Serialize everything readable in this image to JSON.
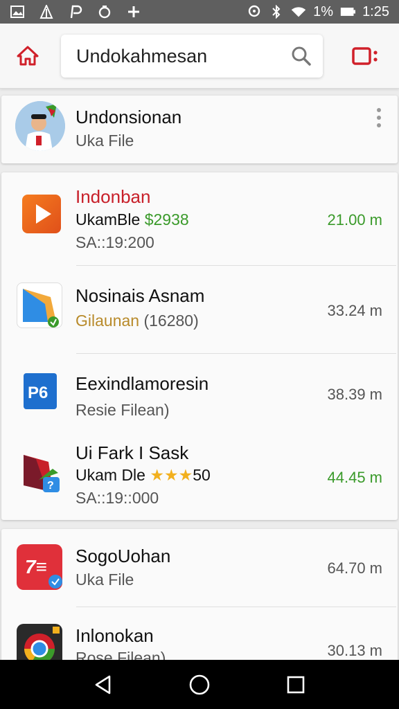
{
  "status_bar": {
    "battery_percent": "1%",
    "time": "1:25"
  },
  "search": {
    "value": "Undokahmesan"
  },
  "profile": {
    "name": "Undonsionan",
    "subtitle": "Uka File"
  },
  "list": [
    {
      "title": "Indonban",
      "subtitle_prefix": "UkamBle",
      "subtitle_highlight": "$2938",
      "meta": "SA::19:200",
      "size": "21.00 m",
      "size_color": "#3a9a2a"
    },
    {
      "title": "Nosinais Asnam",
      "subtitle_prefix": "Gilaunan",
      "subtitle_highlight": "(16280)",
      "size": "33.24 m",
      "size_color": "#555555"
    },
    {
      "title": "Eexindlamoresin",
      "subtitle_prefix": "Resie Filean)",
      "size": "38.39 m",
      "size_color": "#555555"
    },
    {
      "title": "Ui Fark I Sask",
      "subtitle_prefix": "Ukam Dle",
      "stars": "★★★",
      "rating_value": "50",
      "meta": "SA::19::000",
      "size": "44.45 m",
      "size_color": "#3a9a2a"
    }
  ],
  "list2": [
    {
      "title": "SogoUohan",
      "subtitle_prefix": "Uka File",
      "size": "64.70 m"
    },
    {
      "title": "Inlonokan",
      "subtitle_prefix": "Rose Filean)",
      "size": "30.13 m"
    }
  ],
  "colors": {
    "accent": "#d0202a",
    "status_bar": "#5f5f5f",
    "positive": "#3a9a2a"
  },
  "icons": {
    "home": "home-icon",
    "search": "search-icon",
    "menu": "menu-icon",
    "more": "more-vert-icon",
    "nav_back": "back-icon",
    "nav_home": "home-circle-icon",
    "nav_recents": "recents-icon"
  }
}
